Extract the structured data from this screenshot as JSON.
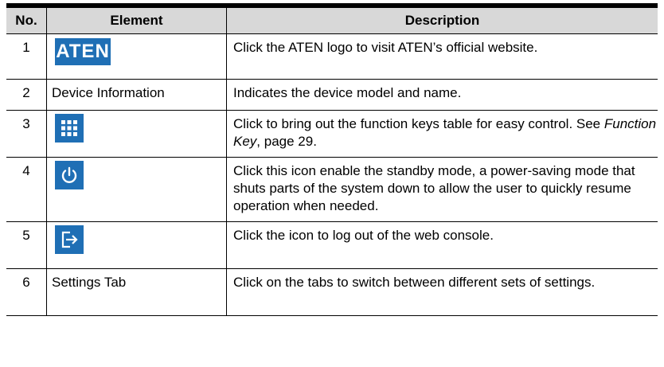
{
  "table": {
    "headers": {
      "no": "No.",
      "element": "Element",
      "description": "Description"
    },
    "rows": [
      {
        "no": "1",
        "element": "",
        "logo_text": "ATEN",
        "description": "Click the ATEN logo to visit ATEN’s official website."
      },
      {
        "no": "2",
        "element": "Device Information",
        "description": "Indicates the device model and name."
      },
      {
        "no": "3",
        "element": "",
        "description_pre": "Click to bring out the function keys table for easy control. See ",
        "description_link": "Function Key",
        "description_post": ", page 29."
      },
      {
        "no": "4",
        "element": "",
        "description": "Click this icon enable the standby mode, a power-saving mode that shuts parts of the system down to allow the user to quickly resume operation when needed."
      },
      {
        "no": "5",
        "element": "",
        "description": "Click the icon to log out of the web console."
      },
      {
        "no": "6",
        "element": "Settings Tab",
        "description": "Click on the tabs to switch between different sets of settings."
      }
    ]
  },
  "colors": {
    "icon_bg": "#1f6fb5",
    "header_bg": "#d8d8d8"
  },
  "icons": [
    "aten-logo",
    "keypad-grid-icon",
    "power-icon",
    "logout-icon"
  ]
}
